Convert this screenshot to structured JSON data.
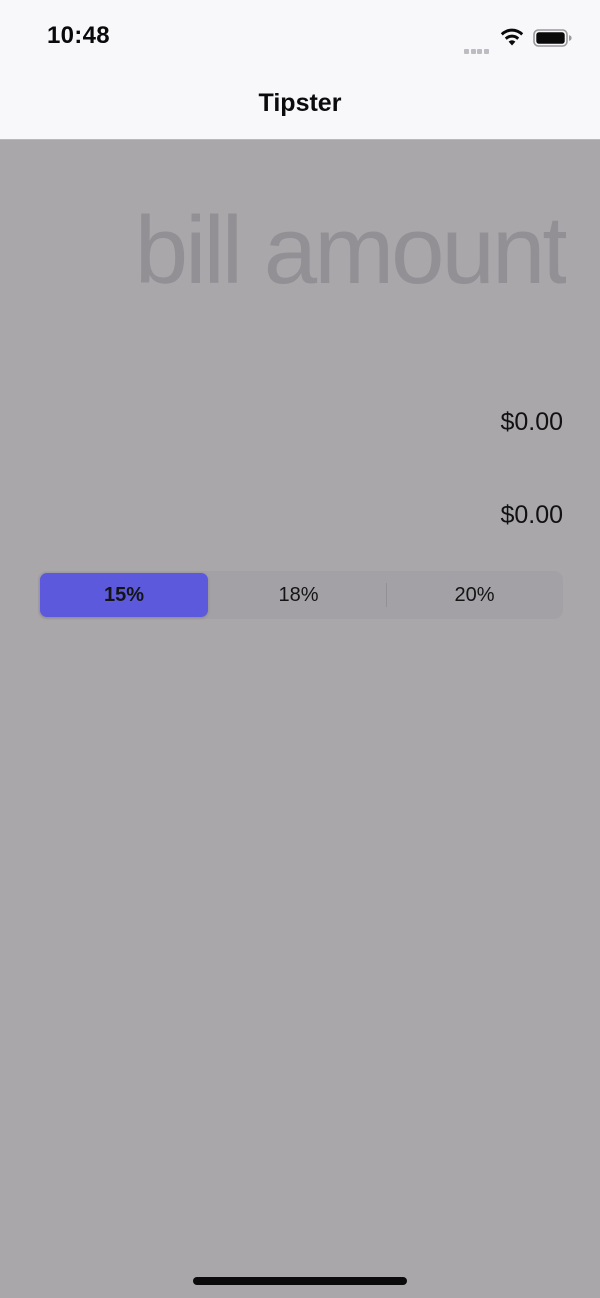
{
  "status_bar": {
    "time": "10:48",
    "signal_icon": "cellular-signal-dots",
    "wifi_icon": "wifi-icon",
    "battery_icon": "battery-icon"
  },
  "nav": {
    "title": "Tipster"
  },
  "bill": {
    "placeholder": "bill amount",
    "value": ""
  },
  "results": {
    "tip": "$0.00",
    "total": "$0.00"
  },
  "tip_selector": {
    "options": [
      "15%",
      "18%",
      "20%"
    ],
    "selected_index": 0,
    "selected_color": "#5c59dd"
  },
  "colors": {
    "background": "#a9a7aa",
    "nav_background": "#f8f7fa"
  }
}
